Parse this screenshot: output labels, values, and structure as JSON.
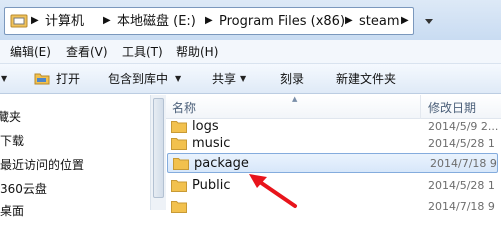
{
  "address_bar": {
    "breadcrumbs": [
      "计算机",
      "本地磁盘 (E:)",
      "Program Files (x86)",
      "steam"
    ]
  },
  "menu": {
    "items": [
      "编辑(E)",
      "查看(V)",
      "工具(T)",
      "帮助(H)"
    ]
  },
  "toolbar": {
    "open_label": "打开",
    "include_label": "包含到库中",
    "share_label": "共享",
    "burn_label": "刻录",
    "new_folder_label": "新建文件夹"
  },
  "nav_pane": {
    "items": [
      "藏夹",
      "下载",
      "最近访问的位置",
      "360云盘",
      "桌面"
    ]
  },
  "file_list": {
    "columns": {
      "name": "名称",
      "date": "修改日期"
    },
    "rows": [
      {
        "name": "logs",
        "date": "2014/5/9 2..."
      },
      {
        "name": "music",
        "date": "2014/5/28 1"
      },
      {
        "name": "package",
        "date": "2014/7/18 9",
        "selected": true
      },
      {
        "name": "Public",
        "date": "2014/5/28 1"
      },
      {
        "name": "",
        "date": "2014/7/18 9"
      }
    ]
  },
  "colors": {
    "selection_border": "#84acdd",
    "annotation_arrow": "#e8141b",
    "folder_yellow": "#f2c14e"
  }
}
